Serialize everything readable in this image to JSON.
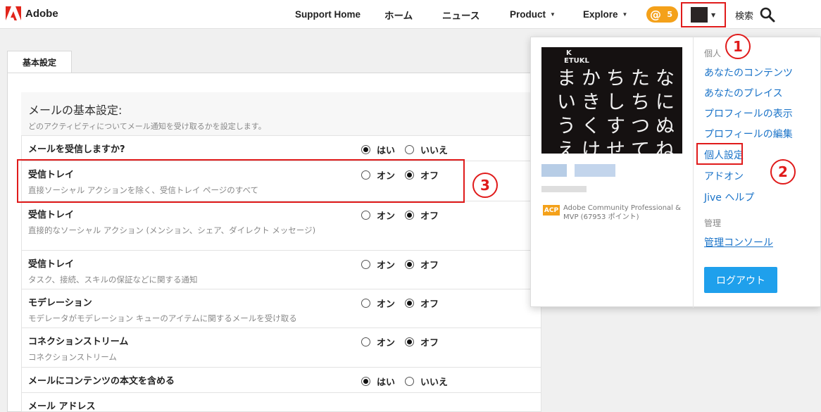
{
  "header": {
    "brand": "Adobe",
    "nav": [
      {
        "label": "Support Home"
      },
      {
        "label": "ホーム"
      },
      {
        "label": "ニュース"
      },
      {
        "label": "Product"
      },
      {
        "label": "Explore"
      }
    ],
    "notification_count": "5",
    "search_label": "検索"
  },
  "tabs": [
    {
      "label": "基本設定"
    }
  ],
  "email_settings": {
    "title": "メールの基本設定:",
    "subtitle": "どのアクティビティについてメール通知を受け取るかを設定します。",
    "rows": [
      {
        "title": "メールを受信しますか?",
        "desc": "",
        "opt1": "はい",
        "opt2": "いいえ",
        "selected": 1
      },
      {
        "title": "受信トレイ",
        "desc": "直接ソーシャル アクションを除く、受信トレイ ページのすべて",
        "opt1": "オン",
        "opt2": "オフ",
        "selected": 2
      },
      {
        "title": "受信トレイ",
        "desc": "直接的なソーシャル アクション (メンション、シェア、ダイレクト メッセージ)",
        "opt1": "オン",
        "opt2": "オフ",
        "selected": 2
      },
      {
        "title": "受信トレイ",
        "desc": "タスク、接続、スキルの保証などに関する通知",
        "opt1": "オン",
        "opt2": "オフ",
        "selected": 2
      },
      {
        "title": "モデレーション",
        "desc": "モデレータがモデレーション キューのアイテムに関するメールを受け取る",
        "opt1": "オン",
        "opt2": "オフ",
        "selected": 2
      },
      {
        "title": "コネクションストリーム",
        "desc": "コネクションストリーム",
        "opt1": "オン",
        "opt2": "オフ",
        "selected": 2
      },
      {
        "title": "メールにコンテンツの本文を含める",
        "desc": "",
        "opt1": "はい",
        "opt2": "いいえ",
        "selected": 1
      },
      {
        "title": "メール アドレス",
        "desc": "",
        "opt1": "",
        "opt2": "",
        "selected": 0
      }
    ]
  },
  "annotations": {
    "m1": "1",
    "m2": "2",
    "m3": "3"
  },
  "dropdown": {
    "profile_img_text": {
      "k": "K",
      "etukl": "ETUKL",
      "grid": "まかちたな\nいきしちに\nうくすつぬ\nえけせてね"
    },
    "badge": "ACP",
    "badge_desc": "Adobe Community Professional & MVP (67953 ポイント)",
    "personal_heading": "個人",
    "links": [
      {
        "label": "あなたのコンテンツ"
      },
      {
        "label": "あなたのプレイス"
      },
      {
        "label": "プロフィールの表示"
      },
      {
        "label": "プロフィールの編集"
      },
      {
        "label": "個人設定"
      },
      {
        "label": "アドオン"
      },
      {
        "label": "Jive ヘルプ"
      }
    ],
    "admin_heading": "管理",
    "admin_link": "管理コンソール",
    "logout": "ログアウト"
  },
  "colors": {
    "annotation_red": "#e01b1b",
    "link_blue": "#1a73c8",
    "button_blue": "#1fa0ec",
    "badge_orange": "#f4a11a"
  }
}
